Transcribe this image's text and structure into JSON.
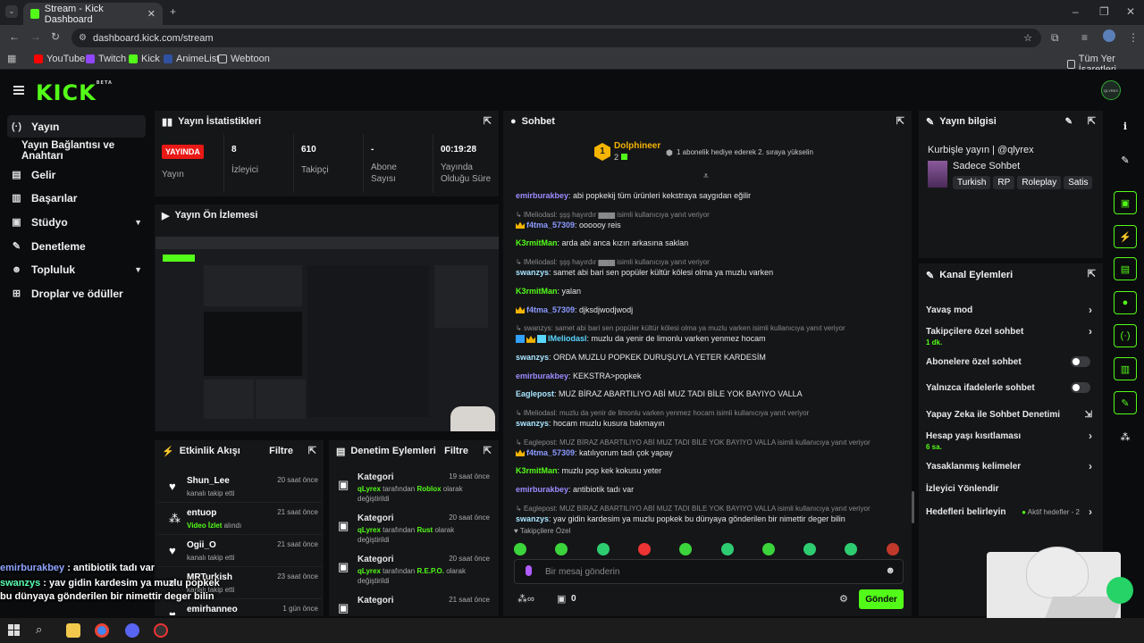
{
  "browser": {
    "tab_title": "Stream - Kick Dashboard",
    "url": "dashboard.kick.com/stream",
    "bookmarks": [
      "YouTube",
      "Twitch",
      "Kick",
      "AnimeList",
      "Webtoon"
    ],
    "all_bookmarks": "Tüm Yer İşaretleri"
  },
  "brand": {
    "logo": "KICK",
    "beta": "BETA",
    "accent": "#53fc18",
    "avatar": "QLYREX"
  },
  "nav": [
    {
      "label": "Yayın",
      "icon": "broadcast-icon"
    },
    {
      "label": "Yayın Bağlantısı ve Anahtarı"
    },
    {
      "label": "Gelir",
      "icon": "revenue-icon"
    },
    {
      "label": "Başarılar",
      "icon": "achievements-icon"
    },
    {
      "label": "Stüdyo",
      "icon": "studio-icon"
    },
    {
      "label": "Denetleme",
      "icon": "wrench-icon"
    },
    {
      "label": "Topluluk",
      "icon": "community-icon"
    },
    {
      "label": "Droplar ve ödüller",
      "icon": "drops-icon"
    }
  ],
  "stats": {
    "title": "Yayın İstatistikleri",
    "live_badge": "YAYINDA",
    "items": [
      {
        "value": "",
        "label": "Yayın"
      },
      {
        "value": "8",
        "label": "İzleyici"
      },
      {
        "value": "610",
        "label": "Takipçi"
      },
      {
        "value": "-",
        "label": "Abone Sayısı"
      },
      {
        "value": "00:19:28",
        "label": "Yayında Olduğu Süre"
      }
    ]
  },
  "preview": {
    "title": "Yayın Ön İzlemesi"
  },
  "activity": {
    "title": "Etkinlik Akışı",
    "filter": "Filtre",
    "items": [
      {
        "name": "Shun_Lee",
        "desc": "kanalı takip etti",
        "highlight": "",
        "time": "20 saat önce",
        "icon": "heart-icon"
      },
      {
        "name": "entuop",
        "desc": "alındı",
        "highlight": "Video İzlet",
        "time": "21 saat önce",
        "icon": "drop-icon"
      },
      {
        "name": "Ogii_O",
        "desc": "kanalı takip etti",
        "highlight": "",
        "time": "21 saat önce",
        "icon": "heart-icon"
      },
      {
        "name": "MRTurkish",
        "desc": "kanalı takip etti",
        "highlight": "",
        "time": "23 saat önce",
        "icon": "heart-icon"
      },
      {
        "name": "emirhanneo",
        "desc": "",
        "highlight": "",
        "time": "1 gün önce",
        "icon": "heart-icon"
      }
    ]
  },
  "moderation": {
    "title": "Denetim Eylemleri",
    "filter": "Filtre",
    "items": [
      {
        "name": "Kategori",
        "user": "qLyrex",
        "mid": "tarafından",
        "cat": "Roblox",
        "end": "olarak değiştirildi",
        "time": "19 saat önce"
      },
      {
        "name": "Kategori",
        "user": "qLyrex",
        "mid": "tarafından",
        "cat": "Rust",
        "end": "olarak değiştirildi",
        "time": "20 saat önce"
      },
      {
        "name": "Kategori",
        "user": "qLyrex",
        "mid": "tarafından",
        "cat": "R.E.P.O.",
        "end": "olarak değiştirildi",
        "time": "20 saat önce"
      },
      {
        "name": "Kategori",
        "user": "",
        "mid": "",
        "cat": "",
        "end": "",
        "time": "21 saat önce"
      }
    ]
  },
  "chat": {
    "title": "Sohbet",
    "pinned_user": "Dolphineer",
    "pinned_rank": "1",
    "pinned_count": "2",
    "pinned_text": "1 abonelik hediye ederek 2. sıraya yükselin",
    "followers_only": "Takipçilere Özel",
    "placeholder": "Bir mesaj gönderin",
    "send": "Gönder",
    "points": "0",
    "messages": [
      {
        "type": "msg",
        "user": "emirburakbey",
        "cls": "u-blue",
        "text": ": abi popkekij tüm ürünleri kekstraya saygıdan eğilir"
      },
      {
        "type": "reply",
        "text": "lMeliodasl: şşş hayırdır ▆▆▆ isimli kullanıcıya yanıt veriyor"
      },
      {
        "type": "msg",
        "user": "f4tma_57309",
        "cls": "u-violet",
        "badge": "crown",
        "text": ": oooooy reis"
      },
      {
        "type": "msg",
        "user": "K3rmitMan",
        "cls": "u-green",
        "text": ": arda abi anca kızın arkasına saklan"
      },
      {
        "type": "reply",
        "text": "lMeliodasl: şşş hayırdır ▆▆▆ isimli kullanıcıya yanıt veriyor"
      },
      {
        "type": "msg",
        "user": "swanzys",
        "cls": "u-pale",
        "text": ": samet abi bari sen popüler kültür kölesi olma ya muzlu varken"
      },
      {
        "type": "msg",
        "user": "K3rmitMan",
        "cls": "u-green",
        "text": ": yalan"
      },
      {
        "type": "msg",
        "user": "f4tma_57309",
        "cls": "u-violet",
        "badge": "crown",
        "text": ": djksdjwodjwodj"
      },
      {
        "type": "reply",
        "text": "swanzys: samet abi bari sen popüler kültür kölesi olma ya muzlu varken isimli kullanıcıya yanıt veriyor"
      },
      {
        "type": "msg",
        "user": "lMeliodasl",
        "cls": "u-cyan",
        "badge": "multi",
        "text": ": muzlu da yenir de limonlu varken yenmez hocam"
      },
      {
        "type": "msg",
        "user": "swanzys",
        "cls": "u-pale",
        "text": ": ORDA MUZLU POPKEK DURUŞUYLA YETER KARDESİM"
      },
      {
        "type": "msg",
        "user": "emirburakbey",
        "cls": "u-blue",
        "text": ": KEKSTRA>popkek"
      },
      {
        "type": "msg",
        "user": "Eaglepost",
        "cls": "u-pale",
        "text": ": MUZ BİRAZ ABARTILIYO ABİ MUZ TADI BİLE YOK BAYIYO VALLA"
      },
      {
        "type": "reply",
        "text": "lMeliodasl: muzlu da yenir de limonlu varken yenmez hocam isimli kullanıcıya yanıt veriyor"
      },
      {
        "type": "msg",
        "user": "swanzys",
        "cls": "u-pale",
        "text": ": hocam muzlu kusura bakmayın"
      },
      {
        "type": "reply",
        "text": "Eaglepost: MUZ BİRAZ ABARTILIYO ABİ MUZ TADI BİLE YOK BAYIYO VALLA isimli kullanıcıya yanıt veriyor"
      },
      {
        "type": "msg",
        "user": "f4tma_57309",
        "cls": "u-violet",
        "badge": "crown",
        "text": ": katılıyorum tadı çok yapay"
      },
      {
        "type": "msg",
        "user": "K3rmitMan",
        "cls": "u-green",
        "text": ": muzlu pop kek kokusu yeter"
      },
      {
        "type": "msg",
        "user": "emirburakbey",
        "cls": "u-blue",
        "text": ": antibiotik tadı var"
      },
      {
        "type": "reply",
        "text": "Eaglepost: MUZ BİRAZ ABARTILIYO ABİ MUZ TADI BİLE YOK BAYIYO VALLA isimli kullanıcıya yanıt veriyor"
      },
      {
        "type": "msg",
        "user": "swanzys",
        "cls": "u-pale",
        "text": ": yav gidin kardesim ya muzlu popkek bu dünyaya gönderilen bir nimettir deger bilin"
      }
    ]
  },
  "stream_info": {
    "title": "Yayın bilgisi",
    "stream_title": "Kurbişle yayın | @qlyrex",
    "category": "Sadece Sohbet",
    "tags": [
      "Turkish",
      "RP",
      "Roleplay",
      "Satis"
    ]
  },
  "channel_actions": {
    "title": "Kanal Eylemleri",
    "items": [
      {
        "label": "Yavaş mod",
        "sub": "",
        "control": "chevron"
      },
      {
        "label": "Takipçilere özel sohbet",
        "sub": "1 dk.",
        "control": "chevron"
      },
      {
        "label": "Abonelere özel sohbet",
        "sub": "",
        "control": "toggle"
      },
      {
        "label": "Yalnızca ifadelerle sohbet",
        "sub": "",
        "control": "toggle"
      },
      {
        "label": "Yapay Zeka ile Sohbet Denetimi",
        "sub": "",
        "control": "external"
      },
      {
        "label": "Hesap yaşı kısıtlaması",
        "sub": "6 sa.",
        "control": "chevron"
      },
      {
        "label": "Yasaklanmış kelimeler",
        "sub": "",
        "control": "chevron"
      },
      {
        "label": "İzleyici Yönlendir",
        "sub": "",
        "control": "none"
      },
      {
        "label": "Hedefleri belirleyin",
        "sub": "",
        "control": "chevron",
        "status": "Aktif hedefler - 2"
      }
    ]
  },
  "overlay_chat": [
    {
      "user": "emirburakbey",
      "text": " : antibiotik tadı var"
    },
    {
      "user": "swanzys",
      "text": " : yav gidin kardesim ya muzlu popkek bu dünyaya gönderilen bir nimettir deger bilin"
    }
  ]
}
